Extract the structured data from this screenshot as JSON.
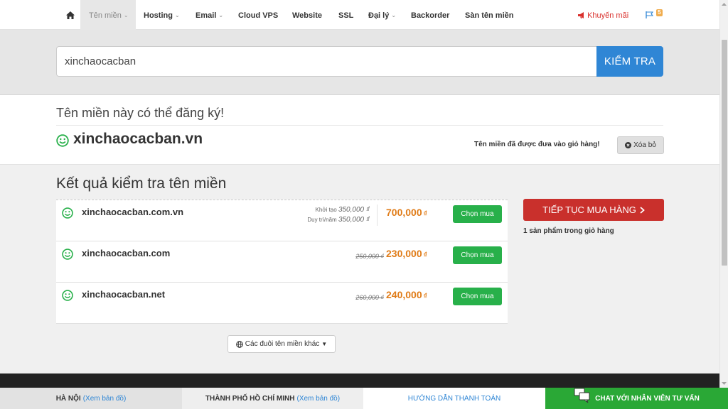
{
  "nav": {
    "items": [
      {
        "label": "Tên miền",
        "dropdown": true,
        "active": true
      },
      {
        "label": "Hosting",
        "dropdown": true
      },
      {
        "label": "Email",
        "dropdown": true
      },
      {
        "label": "Cloud VPS"
      },
      {
        "label": "Website"
      },
      {
        "label": "SSL"
      },
      {
        "label": "Đại lý",
        "dropdown": true
      },
      {
        "label": "Backorder"
      },
      {
        "label": "Sàn tên miền"
      }
    ],
    "promo_label": "Khuyến mãi",
    "notification_count": "5"
  },
  "search": {
    "value": "xinchaocacban",
    "button_label": "KIỂM TRA"
  },
  "available": {
    "title": "Tên miền này có thể đăng ký!",
    "domain": "xinchaocacban.vn",
    "cart_note": "Tên miền đã được đưa vào giỏ hàng!",
    "remove_label": "Xóa bỏ"
  },
  "results": {
    "title": "Kết quả kiểm tra tên miền",
    "rows": [
      {
        "domain": "xinchaocacban.com.vn",
        "setup_label": "Khởi tạo",
        "setup_price": "350,000 ₫",
        "renew_label": "Duy trì/năm",
        "renew_price": "350,000 ₫",
        "price": "700,000",
        "currency": "₫",
        "button": "Chọn mua"
      },
      {
        "domain": "xinchaocacban.com",
        "old_price": "250,000 ₫",
        "price": "230,000",
        "currency": "₫",
        "button": "Chọn mua"
      },
      {
        "domain": "xinchaocacban.net",
        "old_price": "260,000 ₫",
        "price": "240,000",
        "currency": "₫",
        "button": "Chọn mua"
      }
    ],
    "other_label": "Các đuôi tên miền khác"
  },
  "side": {
    "continue_label": "TIẾP TỤC MUA HÀNG",
    "cart_count_text": "1 sản phẩm trong giỏ hàng"
  },
  "bottom_bar": {
    "hanoi": "HÀ NỘI",
    "hanoi_link": "(Xem bản đồ)",
    "hcm": "THÀNH PHỐ HỒ CHÍ MINH",
    "hcm_link": "(Xem bản đồ)",
    "guide": "HƯỚNG DẪN THANH TOÁN",
    "chat": "CHAT VỚI NHÂN VIÊN TƯ VẤN"
  },
  "colors": {
    "primary": "#2f86d5",
    "buy_green": "#28b04a",
    "price_orange": "#e07c18",
    "continue_red": "#c9302c",
    "chat_green": "#2aa836",
    "smile_green": "#28b04a"
  },
  "icons": [
    "home-icon",
    "chevron-down-icon",
    "megaphone-icon",
    "flag-icon",
    "smile-icon",
    "close-circle-icon",
    "globe-icon",
    "caret-down-icon",
    "chevron-right-icon",
    "chat-icon"
  ]
}
